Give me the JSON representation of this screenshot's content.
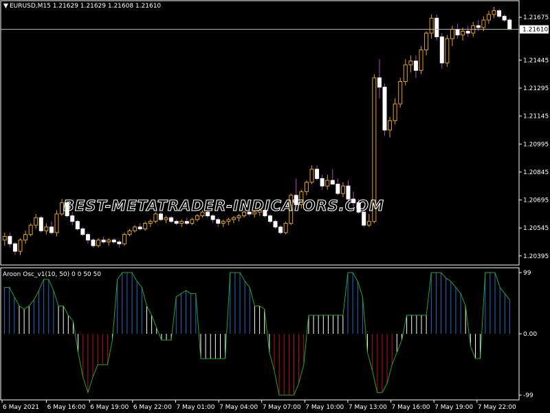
{
  "main": {
    "symbol_line": "EURUSD,M15  1.21629  1.21629  1.21608  1.21610",
    "current_price": "1.21610",
    "price_ticks": [
      {
        "label": "1.21675",
        "value": 1.21675
      },
      {
        "label": "1.21610",
        "value": 1.2161
      },
      {
        "label": "1.21445",
        "value": 1.21445
      },
      {
        "label": "1.21295",
        "value": 1.21295
      },
      {
        "label": "1.21145",
        "value": 1.21145
      },
      {
        "label": "1.20995",
        "value": 1.20995
      },
      {
        "label": "1.20845",
        "value": 1.20845
      },
      {
        "label": "1.20695",
        "value": 1.20695
      },
      {
        "label": "1.20545",
        "value": 1.20545
      },
      {
        "label": "1.20395",
        "value": 1.20395
      }
    ],
    "y_range": [
      1.2035,
      1.2176
    ],
    "watermark": "BEST-METATRADER-INDICATORS.COM",
    "colors": {
      "bull": "#e8a317",
      "bear": "#ffffff",
      "wick_bear": "#c040c0",
      "price_line": "#c0c0c0"
    }
  },
  "sub": {
    "title": "Aroon Osc_v1(10, 50) 0 0 50 50",
    "y_ticks": [
      {
        "label": "99",
        "value": 99
      },
      {
        "label": "0.00",
        "value": 0
      },
      {
        "label": "-99",
        "value": -99
      }
    ],
    "colors": {
      "strong_up": "#1e6fc8",
      "mid": "#ffffff",
      "strong_down": "#c01010",
      "outline": "#22aa22"
    }
  },
  "time_labels": [
    "6 May 2021",
    "6 May 16:00",
    "6 May 19:00",
    "6 May 22:00",
    "7 May 01:00",
    "7 May 04:00",
    "7 May 07:00",
    "7 May 10:00",
    "7 May 13:00",
    "7 May 16:00",
    "7 May 19:00",
    "7 May 22:00"
  ],
  "chart_data": {
    "type": "candlestick",
    "candles": [
      {
        "o": 1.2048,
        "h": 1.2052,
        "l": 1.2045,
        "c": 1.205
      },
      {
        "o": 1.205,
        "h": 1.2052,
        "l": 1.2044,
        "c": 1.2046
      },
      {
        "o": 1.2046,
        "h": 1.2047,
        "l": 1.204,
        "c": 1.2042
      },
      {
        "o": 1.2042,
        "h": 1.2049,
        "l": 1.204,
        "c": 1.2048
      },
      {
        "o": 1.2048,
        "h": 1.2053,
        "l": 1.2046,
        "c": 1.2051
      },
      {
        "o": 1.2051,
        "h": 1.2057,
        "l": 1.205,
        "c": 1.2056
      },
      {
        "o": 1.2056,
        "h": 1.2062,
        "l": 1.2054,
        "c": 1.206
      },
      {
        "o": 1.206,
        "h": 1.2061,
        "l": 1.2052,
        "c": 1.2053
      },
      {
        "o": 1.2053,
        "h": 1.2057,
        "l": 1.2051,
        "c": 1.2055
      },
      {
        "o": 1.2055,
        "h": 1.2058,
        "l": 1.2051,
        "c": 1.2052
      },
      {
        "o": 1.2052,
        "h": 1.2064,
        "l": 1.205,
        "c": 1.2062
      },
      {
        "o": 1.2062,
        "h": 1.207,
        "l": 1.2061,
        "c": 1.2068
      },
      {
        "o": 1.2068,
        "h": 1.2069,
        "l": 1.206,
        "c": 1.2061
      },
      {
        "o": 1.2061,
        "h": 1.2063,
        "l": 1.2056,
        "c": 1.2058
      },
      {
        "o": 1.2058,
        "h": 1.2059,
        "l": 1.2053,
        "c": 1.2054
      },
      {
        "o": 1.2054,
        "h": 1.2055,
        "l": 1.205,
        "c": 1.2051
      },
      {
        "o": 1.2051,
        "h": 1.2052,
        "l": 1.2046,
        "c": 1.2048
      },
      {
        "o": 1.2048,
        "h": 1.2049,
        "l": 1.2044,
        "c": 1.2045
      },
      {
        "o": 1.2045,
        "h": 1.2049,
        "l": 1.2044,
        "c": 1.2048
      },
      {
        "o": 1.2048,
        "h": 1.205,
        "l": 1.2046,
        "c": 1.2047
      },
      {
        "o": 1.2047,
        "h": 1.2049,
        "l": 1.2045,
        "c": 1.2048
      },
      {
        "o": 1.2048,
        "h": 1.2049,
        "l": 1.2046,
        "c": 1.2047
      },
      {
        "o": 1.2047,
        "h": 1.2048,
        "l": 1.2044,
        "c": 1.2046
      },
      {
        "o": 1.2046,
        "h": 1.2052,
        "l": 1.2045,
        "c": 1.2051
      },
      {
        "o": 1.2051,
        "h": 1.2054,
        "l": 1.205,
        "c": 1.2053
      },
      {
        "o": 1.2053,
        "h": 1.2056,
        "l": 1.2052,
        "c": 1.2055
      },
      {
        "o": 1.2055,
        "h": 1.2057,
        "l": 1.2053,
        "c": 1.2054
      },
      {
        "o": 1.2054,
        "h": 1.2058,
        "l": 1.2053,
        "c": 1.2057
      },
      {
        "o": 1.2057,
        "h": 1.2059,
        "l": 1.2055,
        "c": 1.2058
      },
      {
        "o": 1.2058,
        "h": 1.2063,
        "l": 1.2057,
        "c": 1.2062
      },
      {
        "o": 1.2062,
        "h": 1.2063,
        "l": 1.2058,
        "c": 1.2059
      },
      {
        "o": 1.2059,
        "h": 1.2061,
        "l": 1.2057,
        "c": 1.206
      },
      {
        "o": 1.206,
        "h": 1.2061,
        "l": 1.2057,
        "c": 1.2058
      },
      {
        "o": 1.2058,
        "h": 1.2059,
        "l": 1.2056,
        "c": 1.2057
      },
      {
        "o": 1.2057,
        "h": 1.2059,
        "l": 1.2055,
        "c": 1.2058
      },
      {
        "o": 1.2058,
        "h": 1.206,
        "l": 1.2056,
        "c": 1.2057
      },
      {
        "o": 1.2057,
        "h": 1.206,
        "l": 1.2056,
        "c": 1.2059
      },
      {
        "o": 1.2059,
        "h": 1.2062,
        "l": 1.2058,
        "c": 1.2061
      },
      {
        "o": 1.2061,
        "h": 1.2064,
        "l": 1.206,
        "c": 1.2063
      },
      {
        "o": 1.2063,
        "h": 1.2064,
        "l": 1.206,
        "c": 1.2061
      },
      {
        "o": 1.2061,
        "h": 1.2062,
        "l": 1.2057,
        "c": 1.2059
      },
      {
        "o": 1.2059,
        "h": 1.206,
        "l": 1.2055,
        "c": 1.2057
      },
      {
        "o": 1.2057,
        "h": 1.2059,
        "l": 1.2055,
        "c": 1.2058
      },
      {
        "o": 1.2058,
        "h": 1.206,
        "l": 1.2056,
        "c": 1.2059
      },
      {
        "o": 1.2059,
        "h": 1.2061,
        "l": 1.2057,
        "c": 1.206
      },
      {
        "o": 1.206,
        "h": 1.2062,
        "l": 1.2058,
        "c": 1.2061
      },
      {
        "o": 1.2061,
        "h": 1.2064,
        "l": 1.206,
        "c": 1.2063
      },
      {
        "o": 1.2063,
        "h": 1.2065,
        "l": 1.2061,
        "c": 1.2062
      },
      {
        "o": 1.2062,
        "h": 1.2064,
        "l": 1.206,
        "c": 1.2063
      },
      {
        "o": 1.2063,
        "h": 1.2065,
        "l": 1.2061,
        "c": 1.2064
      },
      {
        "o": 1.2064,
        "h": 1.2065,
        "l": 1.206,
        "c": 1.2061
      },
      {
        "o": 1.2061,
        "h": 1.2062,
        "l": 1.2057,
        "c": 1.2058
      },
      {
        "o": 1.2058,
        "h": 1.2059,
        "l": 1.2054,
        "c": 1.2055
      },
      {
        "o": 1.2055,
        "h": 1.2056,
        "l": 1.2051,
        "c": 1.2052
      },
      {
        "o": 1.2052,
        "h": 1.2058,
        "l": 1.2051,
        "c": 1.2057
      },
      {
        "o": 1.2057,
        "h": 1.2073,
        "l": 1.2056,
        "c": 1.2072
      },
      {
        "o": 1.2072,
        "h": 1.2081,
        "l": 1.2066,
        "c": 1.2067
      },
      {
        "o": 1.2067,
        "h": 1.2075,
        "l": 1.2065,
        "c": 1.2074
      },
      {
        "o": 1.2074,
        "h": 1.208,
        "l": 1.2072,
        "c": 1.2079
      },
      {
        "o": 1.2079,
        "h": 1.2088,
        "l": 1.2078,
        "c": 1.2086
      },
      {
        "o": 1.2086,
        "h": 1.2088,
        "l": 1.208,
        "c": 1.2081
      },
      {
        "o": 1.2081,
        "h": 1.2083,
        "l": 1.2075,
        "c": 1.2077
      },
      {
        "o": 1.2077,
        "h": 1.2083,
        "l": 1.2075,
        "c": 1.208
      },
      {
        "o": 1.208,
        "h": 1.2086,
        "l": 1.2078,
        "c": 1.2078
      },
      {
        "o": 1.2078,
        "h": 1.2081,
        "l": 1.2072,
        "c": 1.2073
      },
      {
        "o": 1.2073,
        "h": 1.2079,
        "l": 1.2071,
        "c": 1.2077
      },
      {
        "o": 1.2077,
        "h": 1.208,
        "l": 1.2068,
        "c": 1.207
      },
      {
        "o": 1.207,
        "h": 1.2074,
        "l": 1.2066,
        "c": 1.2068
      },
      {
        "o": 1.2068,
        "h": 1.207,
        "l": 1.2062,
        "c": 1.2063
      },
      {
        "o": 1.2063,
        "h": 1.2066,
        "l": 1.2055,
        "c": 1.2056
      },
      {
        "o": 1.2056,
        "h": 1.2062,
        "l": 1.2055,
        "c": 1.2058
      },
      {
        "o": 1.2058,
        "h": 1.2137,
        "l": 1.2057,
        "c": 1.2135
      },
      {
        "o": 1.2135,
        "h": 1.2145,
        "l": 1.2124,
        "c": 1.213
      },
      {
        "o": 1.213,
        "h": 1.2132,
        "l": 1.2104,
        "c": 1.2107
      },
      {
        "o": 1.2107,
        "h": 1.2114,
        "l": 1.2103,
        "c": 1.2112
      },
      {
        "o": 1.2112,
        "h": 1.2124,
        "l": 1.211,
        "c": 1.2121
      },
      {
        "o": 1.2121,
        "h": 1.2135,
        "l": 1.2119,
        "c": 1.2133
      },
      {
        "o": 1.2133,
        "h": 1.2145,
        "l": 1.2131,
        "c": 1.2142
      },
      {
        "o": 1.2142,
        "h": 1.2147,
        "l": 1.2138,
        "c": 1.2144
      },
      {
        "o": 1.2144,
        "h": 1.2147,
        "l": 1.2135,
        "c": 1.2139
      },
      {
        "o": 1.2139,
        "h": 1.2152,
        "l": 1.2137,
        "c": 1.215
      },
      {
        "o": 1.215,
        "h": 1.216,
        "l": 1.2147,
        "c": 1.2159
      },
      {
        "o": 1.2159,
        "h": 1.2169,
        "l": 1.2156,
        "c": 1.2167
      },
      {
        "o": 1.2167,
        "h": 1.2169,
        "l": 1.2155,
        "c": 1.2157
      },
      {
        "o": 1.2157,
        "h": 1.2159,
        "l": 1.214,
        "c": 1.2143
      },
      {
        "o": 1.2143,
        "h": 1.2158,
        "l": 1.2141,
        "c": 1.2156
      },
      {
        "o": 1.2156,
        "h": 1.2163,
        "l": 1.2152,
        "c": 1.2161
      },
      {
        "o": 1.2161,
        "h": 1.2164,
        "l": 1.2156,
        "c": 1.2158
      },
      {
        "o": 1.2158,
        "h": 1.2162,
        "l": 1.2155,
        "c": 1.216
      },
      {
        "o": 1.216,
        "h": 1.2163,
        "l": 1.2157,
        "c": 1.2159
      },
      {
        "o": 1.2159,
        "h": 1.2165,
        "l": 1.2157,
        "c": 1.2163
      },
      {
        "o": 1.2163,
        "h": 1.2166,
        "l": 1.216,
        "c": 1.2162
      },
      {
        "o": 1.2162,
        "h": 1.2168,
        "l": 1.216,
        "c": 1.2166
      },
      {
        "o": 1.2166,
        "h": 1.2171,
        "l": 1.2164,
        "c": 1.2169
      },
      {
        "o": 1.2169,
        "h": 1.2173,
        "l": 1.2167,
        "c": 1.2171
      },
      {
        "o": 1.2171,
        "h": 1.2172,
        "l": 1.2167,
        "c": 1.2168
      },
      {
        "o": 1.2168,
        "h": 1.2169,
        "l": 1.2165,
        "c": 1.2166
      },
      {
        "o": 1.2166,
        "h": 1.2167,
        "l": 1.2161,
        "c": 1.2161
      }
    ],
    "oscillator": [
      75,
      75,
      60,
      45,
      40,
      45,
      55,
      70,
      88,
      88,
      70,
      45,
      45,
      30,
      20,
      -30,
      -70,
      -95,
      -70,
      -50,
      -50,
      -50,
      -10,
      88,
      99,
      99,
      99,
      85,
      75,
      45,
      30,
      10,
      -10,
      -10,
      -10,
      60,
      65,
      70,
      65,
      65,
      -40,
      -40,
      -40,
      -40,
      -40,
      -40,
      99,
      99,
      99,
      85,
      75,
      45,
      45,
      40,
      -30,
      -60,
      -99,
      -99,
      -99,
      -99,
      -80,
      -50,
      30,
      30,
      30,
      30,
      30,
      30,
      30,
      30,
      99,
      99,
      85,
      60,
      -30,
      -60,
      -95,
      -95,
      -80,
      -50,
      -30,
      -10,
      30,
      30,
      30,
      30,
      30,
      99,
      99,
      99,
      90,
      85,
      75,
      65,
      45,
      -20,
      -40,
      -40,
      99,
      99,
      99,
      75,
      65,
      55
    ]
  }
}
